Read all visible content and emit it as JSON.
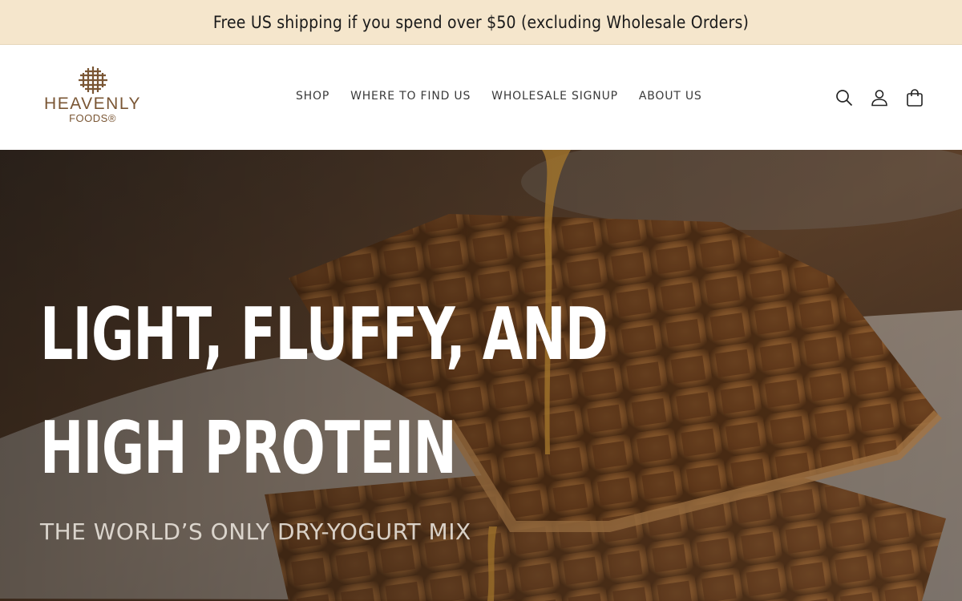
{
  "announcement": {
    "text": "Free US shipping if you spend over $50 (excluding Wholesale Orders)"
  },
  "logo": {
    "word1": "HEAVENLY",
    "word2": "FOODS®",
    "icon": "waffle-grid-logo"
  },
  "nav": {
    "items": [
      {
        "label": "SHOP"
      },
      {
        "label": "WHERE TO FIND US"
      },
      {
        "label": "WHOLESALE SIGNUP"
      },
      {
        "label": "ABOUT US"
      }
    ]
  },
  "header_icons": [
    "search-icon",
    "account-icon",
    "cart-icon"
  ],
  "hero": {
    "title_line1": "LIGHT, FLUFFY, AND",
    "title_line2": "HIGH PROTEIN",
    "subtitle": "THE WORLD’S ONLY DRY-YOGURT MIX",
    "image": "waffles-with-syrup-photo"
  },
  "colors": {
    "announcement_bg": "#f5e6cc",
    "brand_brown": "#7a5634",
    "nav_text": "#3a3a3a",
    "hero_text": "#ffffff"
  }
}
